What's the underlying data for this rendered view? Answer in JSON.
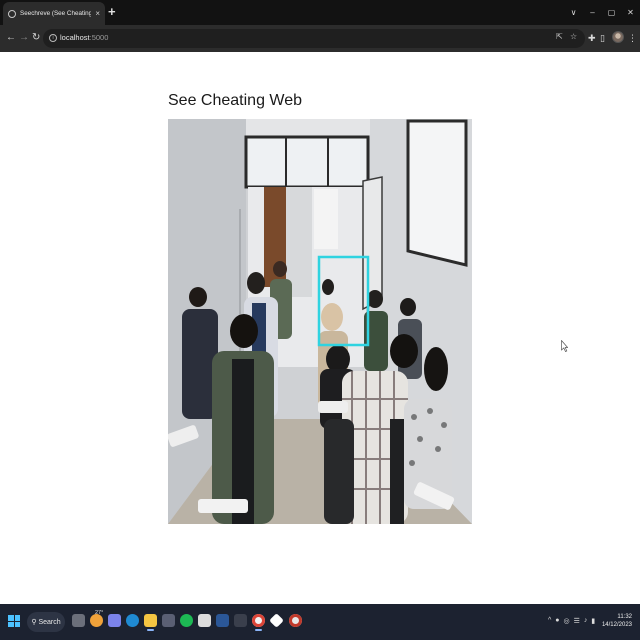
{
  "browser": {
    "tab_title": "Seechreve (See Cheating Web)",
    "tab_close": "×",
    "new_tab": "+",
    "window_controls": [
      "∨",
      "–",
      "▢",
      "✕"
    ],
    "url_host": "localhost",
    "url_port": ":5000",
    "icons": {
      "back": "back-arrow-icon",
      "forward": "forward-arrow-icon",
      "reload": "reload-icon",
      "site_info": "info-icon",
      "share": "share-icon",
      "bookmark": "star-icon",
      "extensions": "puzzle-icon",
      "sidebar": "side-panel-icon",
      "menu": "kebab-menu-icon"
    }
  },
  "page": {
    "title": "See Cheating Web",
    "video_alt": "Classroom camera feed with detection box"
  },
  "taskbar": {
    "search_label": "Search",
    "weather": "27°",
    "tray_chevron": "^",
    "time": "11:32",
    "date": "14/12/2023",
    "apps": [
      "task-view",
      "widgets",
      "chat",
      "edge",
      "file-explorer",
      "store",
      "spotify",
      "calculator",
      "word",
      "phone-link",
      "terminal",
      "vscode",
      "chrome",
      "git",
      "steam"
    ],
    "colors": {
      "accent": "#4cc2ff",
      "running_indicator": "#8ab4f8"
    }
  },
  "detection_box_color": "#2fd3e0"
}
